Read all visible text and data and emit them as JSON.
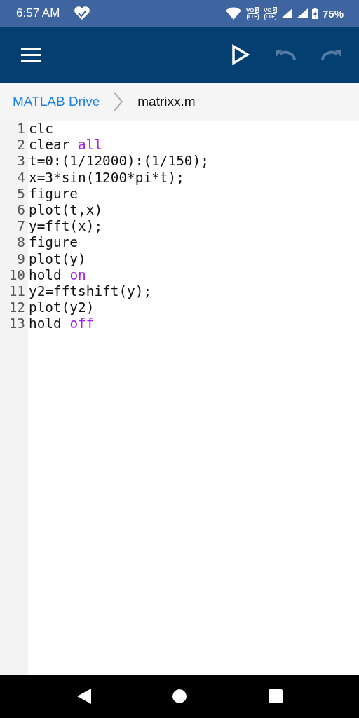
{
  "status_bar": {
    "time": "6:57 AM",
    "sims": [
      {
        "label": "VO",
        "slot": "1",
        "tech": "LTE"
      },
      {
        "label": "VO",
        "slot": "2",
        "tech": "LTE"
      }
    ],
    "battery": "75%"
  },
  "toolbar": {
    "actions": [
      {
        "kind": "run",
        "disabled": false
      },
      {
        "kind": "undo",
        "disabled": true
      },
      {
        "kind": "redo",
        "disabled": true
      }
    ]
  },
  "breadcrumb": {
    "root": "MATLAB Drive",
    "file": "matrixx.m"
  },
  "editor": {
    "lines": [
      {
        "number": "1",
        "tokens": [
          {
            "text": "clc",
            "kind": "plain"
          }
        ]
      },
      {
        "number": "2",
        "tokens": [
          {
            "text": "clear ",
            "kind": "plain"
          },
          {
            "text": "all",
            "kind": "keyword"
          }
        ]
      },
      {
        "number": "3",
        "tokens": [
          {
            "text": "t=0:(1/12000):(1/150);",
            "kind": "plain"
          }
        ]
      },
      {
        "number": "4",
        "tokens": [
          {
            "text": "x=3*sin(1200*pi*t);",
            "kind": "plain"
          }
        ]
      },
      {
        "number": "5",
        "tokens": [
          {
            "text": "figure",
            "kind": "plain"
          }
        ]
      },
      {
        "number": "6",
        "tokens": [
          {
            "text": "plot(t,x)",
            "kind": "plain"
          }
        ]
      },
      {
        "number": "7",
        "tokens": [
          {
            "text": "y=fft(x);",
            "kind": "plain"
          }
        ]
      },
      {
        "number": "8",
        "tokens": [
          {
            "text": "figure",
            "kind": "plain"
          }
        ]
      },
      {
        "number": "9",
        "tokens": [
          {
            "text": "plot(y)",
            "kind": "plain"
          }
        ]
      },
      {
        "number": "10",
        "tokens": [
          {
            "text": "hold ",
            "kind": "plain"
          },
          {
            "text": "on",
            "kind": "keyword"
          }
        ]
      },
      {
        "number": "11",
        "tokens": [
          {
            "text": "y2=fftshift(y);",
            "kind": "plain"
          }
        ]
      },
      {
        "number": "12",
        "tokens": [
          {
            "text": "plot(y2)",
            "kind": "plain"
          }
        ]
      },
      {
        "number": "13",
        "tokens": [
          {
            "text": "hold ",
            "kind": "plain"
          },
          {
            "text": "off",
            "kind": "keyword"
          }
        ]
      }
    ]
  }
}
